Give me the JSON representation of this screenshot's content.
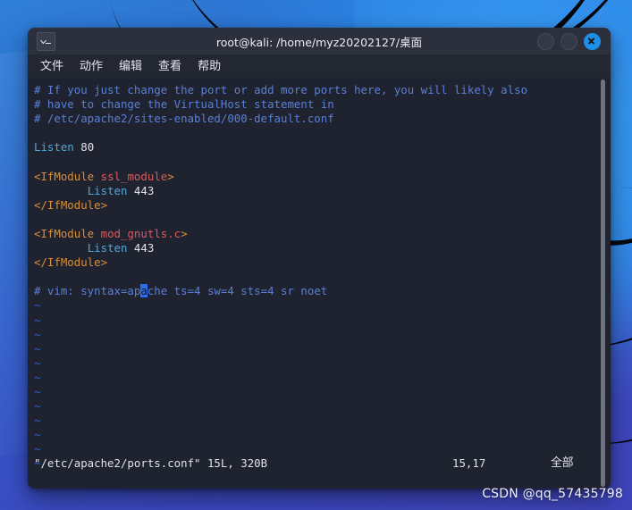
{
  "desktop": {
    "watermark": "CSDN @qq_57435798",
    "wallpaper_colors": {
      "blue_light": "#2f93ef",
      "blue_mid": "#2c6fd0",
      "purple": "#3f44bb",
      "swoosh": "#05070b"
    }
  },
  "window": {
    "title": "root@kali: /home/myz20202127/桌面",
    "icon": "terminal-icon",
    "controls": {
      "minimize": "minimize-button",
      "maximize": "maximize-button",
      "close": "close-button",
      "close_color": "#1e8fe8"
    },
    "menu": [
      {
        "label": "文件"
      },
      {
        "label": "动作"
      },
      {
        "label": "编辑"
      },
      {
        "label": "查看"
      },
      {
        "label": "帮助"
      }
    ]
  },
  "editor": {
    "lines": [
      {
        "segments": [
          {
            "text": "# If you just change the port or add more ports here, you will likely also",
            "cls": "c-comment"
          }
        ]
      },
      {
        "segments": [
          {
            "text": "# have to change the VirtualHost statement in",
            "cls": "c-comment"
          }
        ]
      },
      {
        "segments": [
          {
            "text": "# /etc/apache2/sites-enabled/000-default.conf",
            "cls": "c-comment"
          }
        ]
      },
      {
        "segments": [
          {
            "text": "",
            "cls": "c-comment"
          }
        ]
      },
      {
        "segments": [
          {
            "text": "Listen",
            "cls": "c-keyword"
          },
          {
            "text": " ",
            "cls": "c-number"
          },
          {
            "text": "80",
            "cls": "c-number"
          }
        ]
      },
      {
        "segments": [
          {
            "text": "",
            "cls": "c-comment"
          }
        ]
      },
      {
        "segments": [
          {
            "text": "<IfModule ",
            "cls": "c-tag"
          },
          {
            "text": "ssl_module",
            "cls": "c-module"
          },
          {
            "text": ">",
            "cls": "c-tag"
          }
        ]
      },
      {
        "segments": [
          {
            "text": "        ",
            "cls": "c-number"
          },
          {
            "text": "Listen",
            "cls": "c-keyword"
          },
          {
            "text": " 443",
            "cls": "c-number"
          }
        ]
      },
      {
        "segments": [
          {
            "text": "</IfModule>",
            "cls": "c-tag"
          }
        ]
      },
      {
        "segments": [
          {
            "text": "",
            "cls": "c-comment"
          }
        ]
      },
      {
        "segments": [
          {
            "text": "<IfModule ",
            "cls": "c-tag"
          },
          {
            "text": "mod_gnutls.c",
            "cls": "c-module"
          },
          {
            "text": ">",
            "cls": "c-tag"
          }
        ]
      },
      {
        "segments": [
          {
            "text": "        ",
            "cls": "c-number"
          },
          {
            "text": "Listen",
            "cls": "c-keyword"
          },
          {
            "text": " 443",
            "cls": "c-number"
          }
        ]
      },
      {
        "segments": [
          {
            "text": "</IfModule>",
            "cls": "c-tag"
          }
        ]
      },
      {
        "segments": [
          {
            "text": "",
            "cls": "c-comment"
          }
        ]
      },
      {
        "segments": [
          {
            "text": "# vim: syntax=ap",
            "cls": "c-comment"
          },
          {
            "text": "a",
            "cls": "c-comment cursor"
          },
          {
            "text": "che ts=4 sw=4 sts=4 sr noet",
            "cls": "c-comment"
          }
        ]
      },
      {
        "segments": [
          {
            "text": "~",
            "cls": "c-tilde"
          }
        ]
      },
      {
        "segments": [
          {
            "text": "~",
            "cls": "c-tilde"
          }
        ]
      },
      {
        "segments": [
          {
            "text": "~",
            "cls": "c-tilde"
          }
        ]
      },
      {
        "segments": [
          {
            "text": "~",
            "cls": "c-tilde"
          }
        ]
      },
      {
        "segments": [
          {
            "text": "~",
            "cls": "c-tilde"
          }
        ]
      },
      {
        "segments": [
          {
            "text": "~",
            "cls": "c-tilde"
          }
        ]
      },
      {
        "segments": [
          {
            "text": "~",
            "cls": "c-tilde"
          }
        ]
      },
      {
        "segments": [
          {
            "text": "~",
            "cls": "c-tilde"
          }
        ]
      },
      {
        "segments": [
          {
            "text": "~",
            "cls": "c-tilde"
          }
        ]
      },
      {
        "segments": [
          {
            "text": "~",
            "cls": "c-tilde"
          }
        ]
      },
      {
        "segments": [
          {
            "text": "~",
            "cls": "c-tilde"
          }
        ]
      },
      {
        "segments": [
          {
            "text": "~",
            "cls": "c-tilde"
          }
        ]
      }
    ],
    "status": {
      "file": "\"/etc/apache2/ports.conf\" 15L, 320B",
      "position": "15,17",
      "scope": "全部"
    },
    "cursor": {
      "line": 15,
      "col": 17,
      "char": "a",
      "color": "#2d6ff0"
    },
    "colors": {
      "background": "#1f2330",
      "comment": "#5a7fd6",
      "keyword": "#4ea8dd",
      "tag": "#d98f3a",
      "module": "#e0565f",
      "text": "#e0e3ea",
      "tilde": "#2d5fd8"
    }
  }
}
